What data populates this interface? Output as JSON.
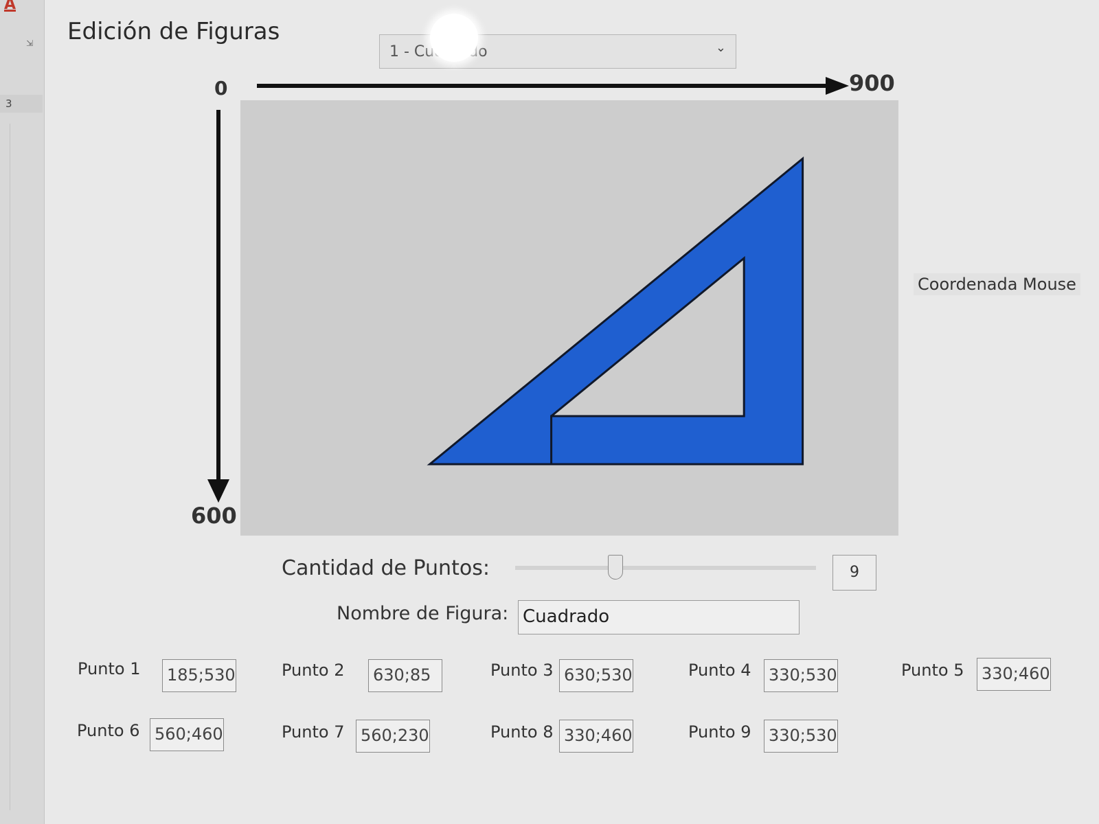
{
  "sidebar": {
    "mark": "A",
    "row_number": "3",
    "expand_icon": "expand-icon"
  },
  "app": {
    "title": "Edición de Figuras"
  },
  "figure_select": {
    "value": "1 - Cuadrado",
    "icon": "chevron-down-icon"
  },
  "axes": {
    "x_start": "0",
    "x_end": "900",
    "y_end": "600"
  },
  "mouse": {
    "coord_label": "Coordenada Mouse"
  },
  "controls": {
    "points_label": "Cantidad de Puntos:",
    "points_value": "9",
    "slider_value": 9,
    "name_label": "Nombre de Figura:",
    "name_value": "Cuadrado"
  },
  "points": [
    {
      "label": "Punto 1",
      "value": "185;530"
    },
    {
      "label": "Punto 2",
      "value": "630;85"
    },
    {
      "label": "Punto 3",
      "value": "630;530"
    },
    {
      "label": "Punto 4",
      "value": "330;530"
    },
    {
      "label": "Punto 5",
      "value": "330;460"
    },
    {
      "label": "Punto 6",
      "value": "560;460"
    },
    {
      "label": "Punto 7",
      "value": "560;230"
    },
    {
      "label": "Punto 8",
      "value": "330;460"
    },
    {
      "label": "Punto 9",
      "value": "330;530"
    }
  ],
  "colors": {
    "figure_fill": "#1f5fd0",
    "figure_stroke": "#10182a",
    "canvas": "#cdcdcd"
  }
}
